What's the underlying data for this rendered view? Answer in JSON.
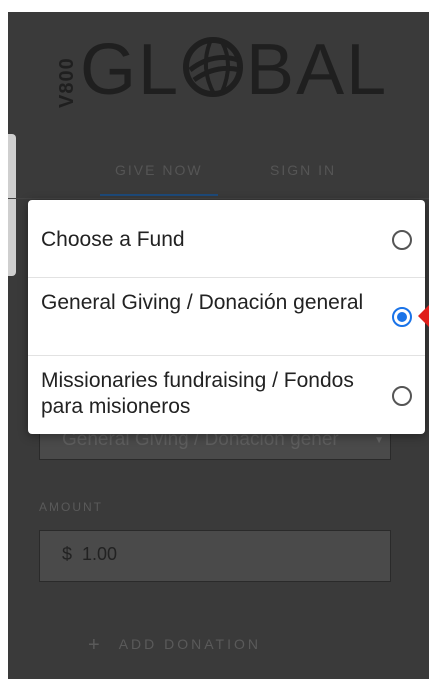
{
  "logo": {
    "prefix": "V800",
    "word_left": "GL",
    "word_right": "BAL"
  },
  "tabs": [
    {
      "label": "GIVE NOW"
    },
    {
      "label": "SIGN IN"
    }
  ],
  "form": {
    "fund_value": "General Giving / Donación gener",
    "amount_label": "AMOUNT",
    "currency": "$",
    "amount_value": "1.00",
    "add_donation": "ADD DONATION"
  },
  "dialog": {
    "options": [
      {
        "label": "Choose a Fund",
        "selected": false
      },
      {
        "label": "General Giving / Donación general",
        "selected": true
      },
      {
        "label": "Missionaries fundraising / Fondos para misioneros",
        "selected": false
      }
    ]
  },
  "colors": {
    "accent": "#1a73e8",
    "annotation_arrow": "#e0201b",
    "overlay": "#3a3a3a"
  }
}
